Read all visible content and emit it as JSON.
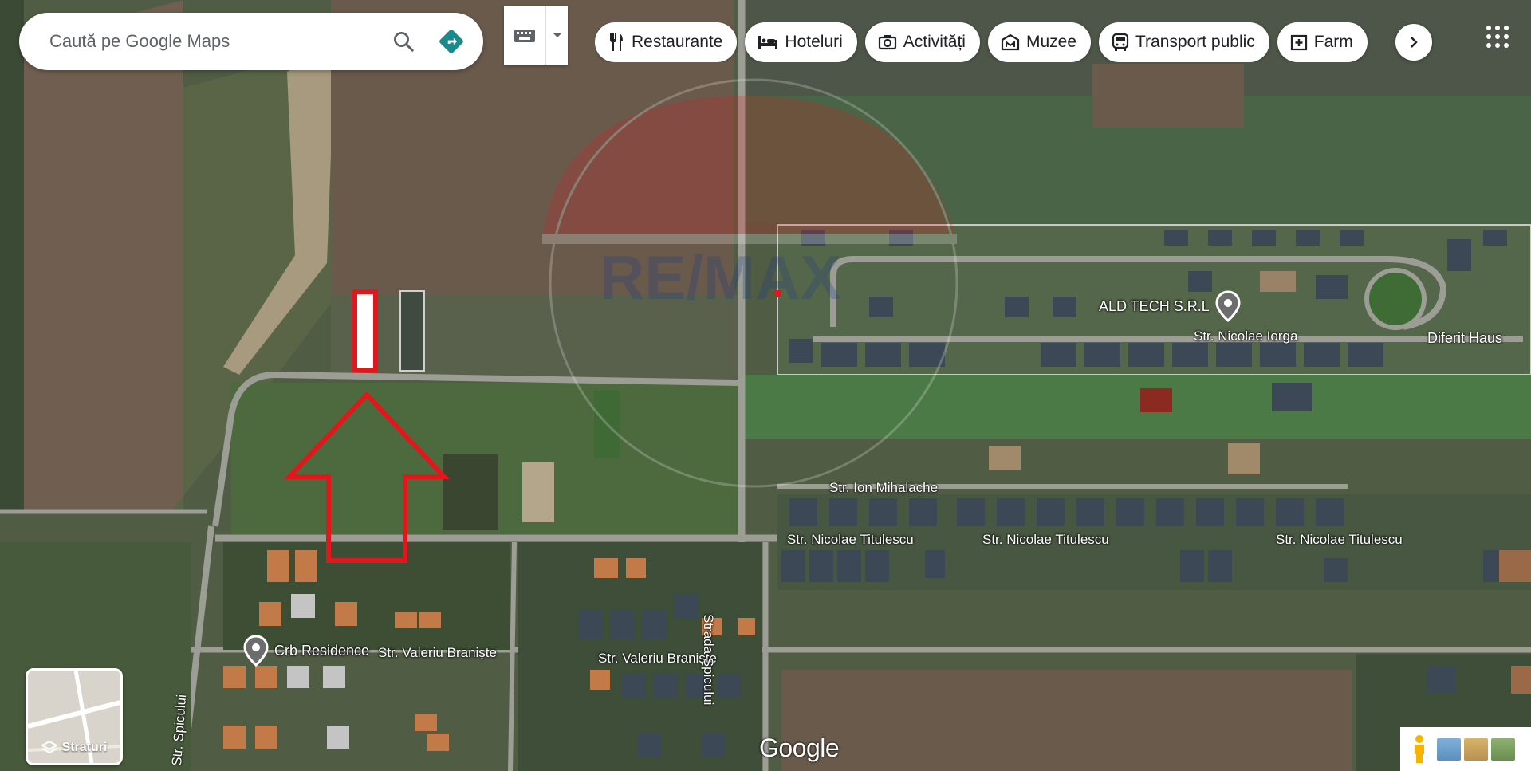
{
  "search": {
    "placeholder": "Caută pe Google Maps"
  },
  "chips": [
    {
      "label": "Restaurante",
      "icon": "fork-knife-icon"
    },
    {
      "label": "Hoteluri",
      "icon": "bed-icon"
    },
    {
      "label": "Activități",
      "icon": "camera-icon"
    },
    {
      "label": "Muzee",
      "icon": "museum-icon"
    },
    {
      "label": "Transport public",
      "icon": "bus-icon"
    },
    {
      "label": "Farm",
      "icon": "pharmacy-icon"
    }
  ],
  "pois": {
    "ald_tech": "ALD TECH S.R.L",
    "diferit_haus": "Diferit Haus",
    "crb_residence": "Crb Residence"
  },
  "streets": {
    "nicolae_iorga": "Str. Nicolae Iorga",
    "ion_mihalache": "Str. Ion Mihalache",
    "titulescu_1": "Str. Nicolae Titulescu",
    "titulescu_2": "Str. Nicolae Titulescu",
    "titulescu_3": "Str. Nicolae Titulescu",
    "valeriu_1": "Str. Valeriu Braniște",
    "valeriu_2": "Str. Valeriu Braniște",
    "spicului_vertical": "Strada Spicului",
    "spicului_left": "Str. Spicului"
  },
  "layers": {
    "label": "Straturi"
  },
  "brand": {
    "logo_text": "Google"
  },
  "watermark": {
    "text": "RE/MAX"
  },
  "colors": {
    "marker_red": "#e3161b",
    "route_teal": "#1a8a8a",
    "field_brown": "#6a5a4a",
    "grass_green": "#4f6b3e"
  }
}
